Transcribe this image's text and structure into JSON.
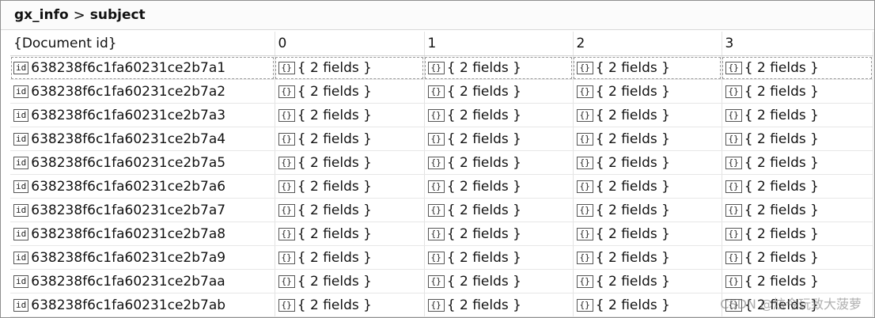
{
  "breadcrumb": {
    "collection": "gx_info",
    "field": "subject"
  },
  "columns": [
    "{Document id}",
    "0",
    "1",
    "2",
    "3"
  ],
  "icons": {
    "id_tag": "id",
    "object_tag": "{}"
  },
  "rows": [
    {
      "id": "638238f6c1fa60231ce2b7a1",
      "cells": [
        "{ 2 fields }",
        "{ 2 fields }",
        "{ 2 fields }",
        "{ 2 fields }"
      ]
    },
    {
      "id": "638238f6c1fa60231ce2b7a2",
      "cells": [
        "{ 2 fields }",
        "{ 2 fields }",
        "{ 2 fields }",
        "{ 2 fields }"
      ]
    },
    {
      "id": "638238f6c1fa60231ce2b7a3",
      "cells": [
        "{ 2 fields }",
        "{ 2 fields }",
        "{ 2 fields }",
        "{ 2 fields }"
      ]
    },
    {
      "id": "638238f6c1fa60231ce2b7a4",
      "cells": [
        "{ 2 fields }",
        "{ 2 fields }",
        "{ 2 fields }",
        "{ 2 fields }"
      ]
    },
    {
      "id": "638238f6c1fa60231ce2b7a5",
      "cells": [
        "{ 2 fields }",
        "{ 2 fields }",
        "{ 2 fields }",
        "{ 2 fields }"
      ]
    },
    {
      "id": "638238f6c1fa60231ce2b7a6",
      "cells": [
        "{ 2 fields }",
        "{ 2 fields }",
        "{ 2 fields }",
        "{ 2 fields }"
      ]
    },
    {
      "id": "638238f6c1fa60231ce2b7a7",
      "cells": [
        "{ 2 fields }",
        "{ 2 fields }",
        "{ 2 fields }",
        "{ 2 fields }"
      ]
    },
    {
      "id": "638238f6c1fa60231ce2b7a8",
      "cells": [
        "{ 2 fields }",
        "{ 2 fields }",
        "{ 2 fields }",
        "{ 2 fields }"
      ]
    },
    {
      "id": "638238f6c1fa60231ce2b7a9",
      "cells": [
        "{ 2 fields }",
        "{ 2 fields }",
        "{ 2 fields }",
        "{ 2 fields }"
      ]
    },
    {
      "id": "638238f6c1fa60231ce2b7aa",
      "cells": [
        "{ 2 fields }",
        "{ 2 fields }",
        "{ 2 fields }",
        "{ 2 fields }"
      ]
    },
    {
      "id": "638238f6c1fa60231ce2b7ab",
      "cells": [
        "{ 2 fields }",
        "{ 2 fields }",
        "{ 2 fields }",
        "{ 2 fields }"
      ]
    }
  ],
  "watermark": "CSDN @炫今玩致大菠萝"
}
